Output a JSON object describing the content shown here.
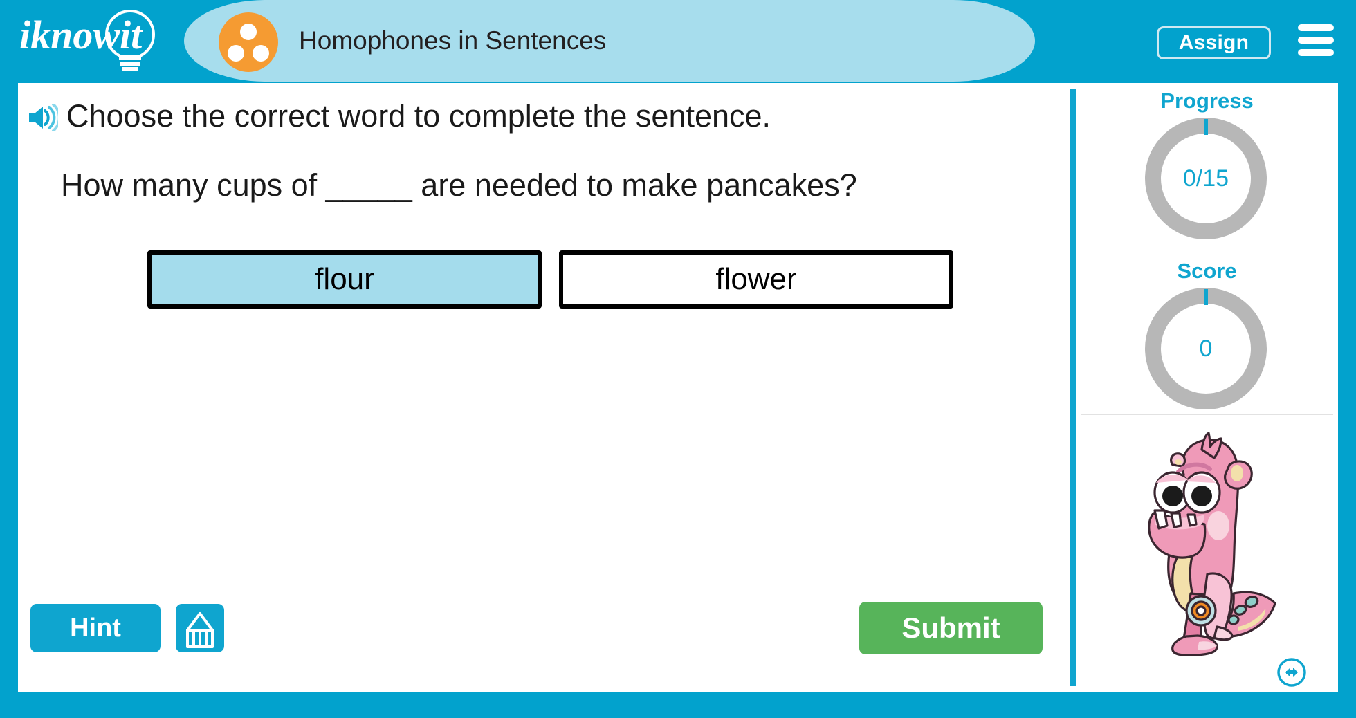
{
  "header": {
    "logo_text": "iknowit",
    "logo_icon": "lightbulb-icon",
    "topic_icon": "three-dots-circle-icon",
    "topic_title": "Homophones in Sentences",
    "assign_label": "Assign",
    "menu_icon": "hamburger-menu-icon"
  },
  "question": {
    "speaker_icon": "speaker-audio-icon",
    "instruction": "Choose the correct word to complete the sentence.",
    "sentence_before": "How many cups of ",
    "sentence_blank": "_____",
    "sentence_after": " are needed to make pancakes?",
    "choices": [
      {
        "label": "flour",
        "selected": true
      },
      {
        "label": "flower",
        "selected": false
      }
    ]
  },
  "actions": {
    "hint_label": "Hint",
    "scratchpad_icon": "pencil-scratchpad-icon",
    "submit_label": "Submit"
  },
  "sidebar": {
    "progress_label": "Progress",
    "progress_value": "0/15",
    "score_label": "Score",
    "score_value": "0",
    "mascot_icon": "pink-dinosaur-mascot",
    "resize_icon": "horizontal-double-arrow-icon"
  },
  "colors": {
    "brand_blue": "#02a2cd",
    "accent_blue": "#0fa5cf",
    "tab_light_blue": "#a7dded",
    "selected_choice": "#a4dcec",
    "topic_orange": "#f59b32",
    "submit_green": "#57b45a",
    "ring_gray": "#b7b7b7",
    "mascot_pink": "#ef9ab8"
  }
}
